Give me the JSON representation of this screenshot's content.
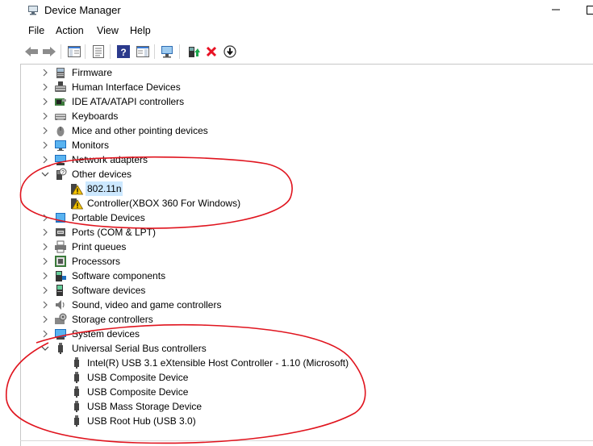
{
  "window": {
    "title": "Device Manager",
    "app_icon": "device-manager-icon",
    "controls": [
      "minimize-icon",
      "maximize-icon"
    ]
  },
  "menu": {
    "items": [
      "File",
      "Action",
      "View",
      "Help"
    ]
  },
  "toolbar": {
    "buttons": [
      "back-arrow-icon",
      "forward-arrow-icon",
      "show-hide-console-tree-icon",
      "properties-icon",
      "help-icon",
      "action-pane-icon",
      "scan-hardware-icon",
      "update-driver-icon",
      "uninstall-device-icon",
      "disable-device-icon"
    ]
  },
  "tree": {
    "categories": [
      {
        "label": "Firmware",
        "icon": "firmware-icon",
        "expanded": false
      },
      {
        "label": "Human Interface Devices",
        "icon": "hid-icon",
        "expanded": false
      },
      {
        "label": "IDE ATA/ATAPI controllers",
        "icon": "ide-controller-icon",
        "expanded": false
      },
      {
        "label": "Keyboards",
        "icon": "keyboard-icon",
        "expanded": false
      },
      {
        "label": "Mice and other pointing devices",
        "icon": "mouse-icon",
        "expanded": false
      },
      {
        "label": "Monitors",
        "icon": "monitor-icon",
        "expanded": false
      },
      {
        "label": "Network adapters",
        "icon": "network-adapter-icon",
        "expanded": false
      },
      {
        "label": "Other devices",
        "icon": "unknown-device-icon",
        "expanded": true
      },
      {
        "label": "802.11n",
        "icon": "warning-device-icon",
        "child": true,
        "selected": true
      },
      {
        "label": "Controller(XBOX 360 For Windows)",
        "icon": "warning-device-icon",
        "child": true
      },
      {
        "label": "Portable Devices",
        "icon": "portable-device-icon",
        "expanded": false
      },
      {
        "label": "Ports (COM & LPT)",
        "icon": "port-icon",
        "expanded": false
      },
      {
        "label": "Print queues",
        "icon": "printer-icon",
        "expanded": false
      },
      {
        "label": "Processors",
        "icon": "processor-icon",
        "expanded": false
      },
      {
        "label": "Software components",
        "icon": "software-component-icon",
        "expanded": false
      },
      {
        "label": "Software devices",
        "icon": "software-device-icon",
        "expanded": false
      },
      {
        "label": "Sound, video and game controllers",
        "icon": "speaker-icon",
        "expanded": false
      },
      {
        "label": "Storage controllers",
        "icon": "storage-controller-icon",
        "expanded": false
      },
      {
        "label": "System devices",
        "icon": "system-device-icon",
        "expanded": false
      },
      {
        "label": "Universal Serial Bus controllers",
        "icon": "usb-icon",
        "expanded": true
      },
      {
        "label": "Intel(R) USB 3.1 eXtensible Host Controller - 1.10 (Microsoft)",
        "icon": "usb-icon",
        "child": true
      },
      {
        "label": "USB Composite Device",
        "icon": "usb-icon",
        "child": true
      },
      {
        "label": "USB Composite Device",
        "icon": "usb-icon",
        "child": true
      },
      {
        "label": "USB Mass Storage Device",
        "icon": "usb-icon",
        "child": true
      },
      {
        "label": "USB Root Hub (USB 3.0)",
        "icon": "usb-icon",
        "child": true
      }
    ]
  },
  "colors": {
    "selection": "#cce8ff",
    "annotation": "#e0141e",
    "warning": "#f4c400",
    "uninstall": "#e81123"
  }
}
